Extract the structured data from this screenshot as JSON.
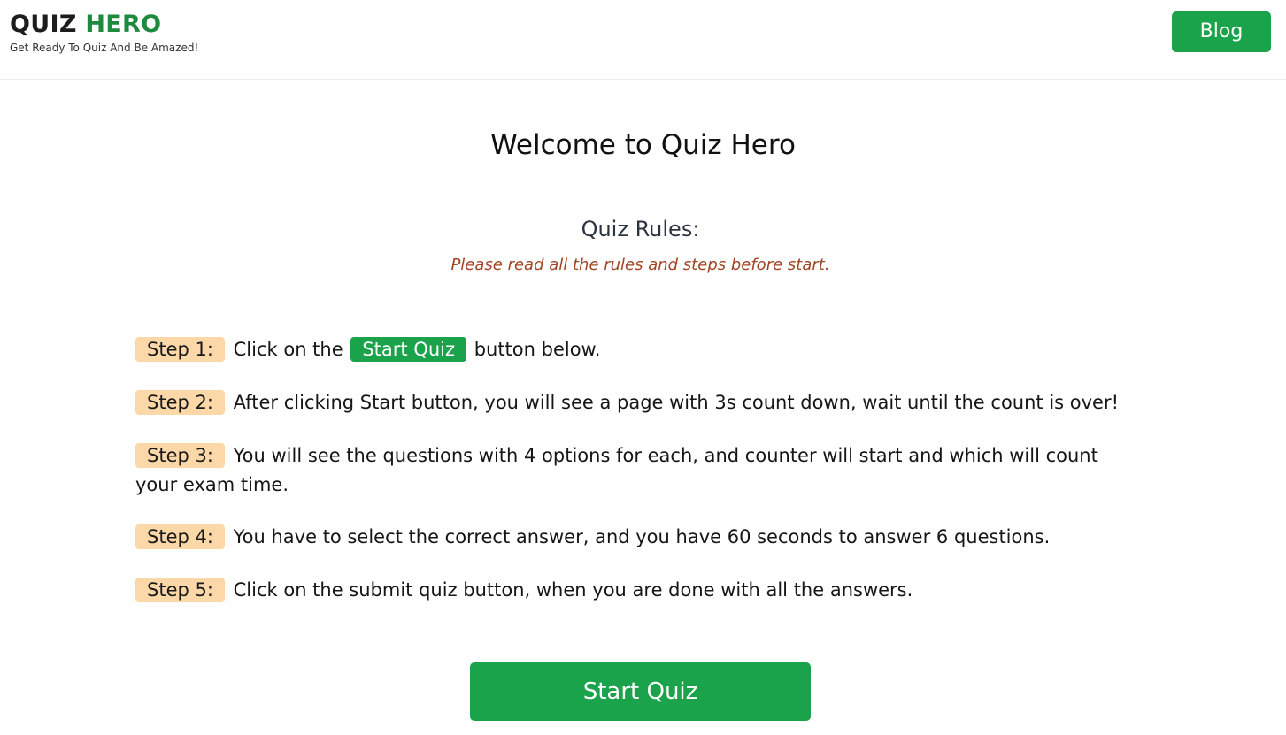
{
  "header": {
    "brand_part1": "QUIZ",
    "brand_part2": "HERO",
    "tagline": "Get Ready To Quiz And Be Amazed!",
    "blog_label": "Blog"
  },
  "main": {
    "welcome": "Welcome to Quiz Hero",
    "rules_title": "Quiz Rules:",
    "rules_note": "Please read all the rules and steps before start.",
    "steps": [
      {
        "badge": "Step 1:",
        "text_before": "Click on the",
        "inline_button": "Start Quiz",
        "text_after": "button below."
      },
      {
        "badge": "Step 2:",
        "text": "After clicking Start button, you will see a page with 3s count down, wait until the count is over!"
      },
      {
        "badge": "Step 3:",
        "text": "You will see the questions with 4 options for each, and counter will start and which will count your exam time."
      },
      {
        "badge": "Step 4:",
        "text": "You have to select the correct answer, and you have 60 seconds to answer 6 questions."
      },
      {
        "badge": "Step 5:",
        "text": "Click on the submit quiz button, when you are done with all the answers."
      }
    ],
    "start_button": "Start Quiz"
  },
  "colors": {
    "brand_green": "#1e8a3e",
    "button_green": "#1aa34a",
    "badge_bg": "#fcd8a8",
    "note_color": "#a14524"
  }
}
